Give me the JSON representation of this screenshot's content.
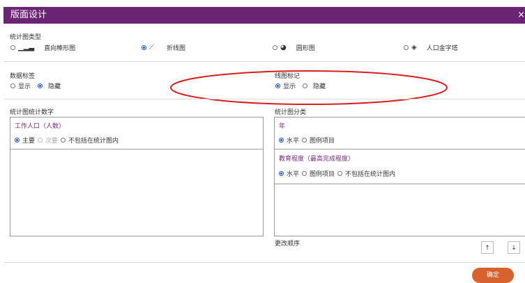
{
  "dialog": {
    "title": "版面设计",
    "close": "×"
  },
  "chart_type": {
    "heading": "统计图类型",
    "options": [
      {
        "label": "直向棒形图",
        "icon": "vertical-bar-chart-icon",
        "selected": false
      },
      {
        "label": "折线图",
        "icon": "line-chart-icon",
        "selected": true
      },
      {
        "label": "圆形图",
        "icon": "pie-chart-icon",
        "selected": false
      },
      {
        "label": "人口金字塔",
        "icon": "population-pyramid-icon",
        "selected": false
      }
    ]
  },
  "data_labels": {
    "heading": "数据标签",
    "show": "显示",
    "hide": "隐藏"
  },
  "line_markers": {
    "heading": "线图标记",
    "show": "显示",
    "hide": "隐藏"
  },
  "stat_numbers": {
    "heading": "统计图统计数字",
    "item": "工作人口（人数）",
    "primary": "主要",
    "secondary": "次要",
    "exclude": "不包括在统计图内"
  },
  "classification": {
    "heading": "统计图分类",
    "group1": {
      "title": "年",
      "horizontal": "水平",
      "legend": "图例项目"
    },
    "group2": {
      "title": "教育程度（最高完成程度）",
      "horizontal": "水平",
      "legend": "图例项目",
      "exclude": "不包括在统计图内"
    },
    "reorder": "更改顺序",
    "up": "↑",
    "down": "↓"
  },
  "confirm": "确定",
  "colors": {
    "titlebar": "#6b2473",
    "accent": "#1a57d6",
    "confirm": "#d8622e",
    "annotation": "#d81e1e"
  }
}
